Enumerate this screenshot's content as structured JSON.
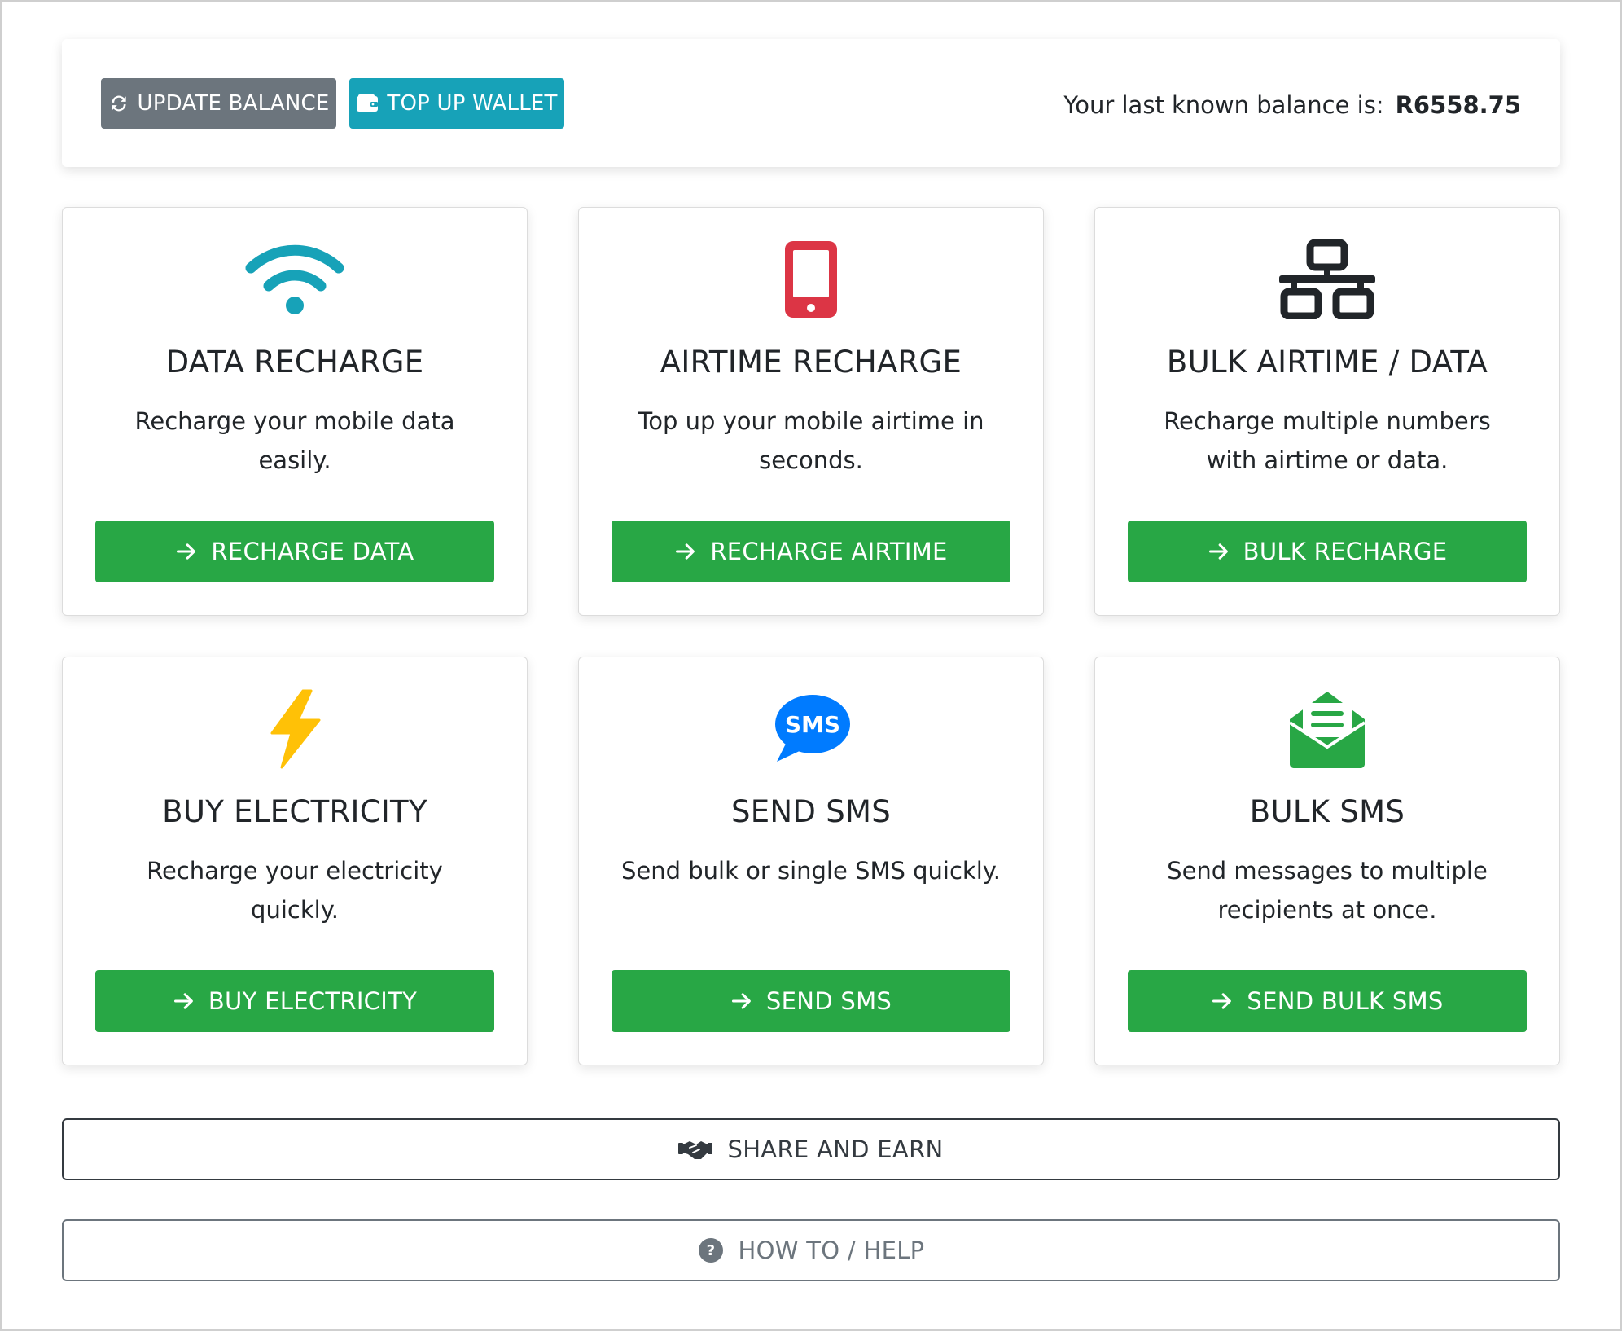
{
  "topbar": {
    "update_label": "UPDATE BALANCE",
    "topup_label": "TOP UP WALLET",
    "balance_text": "Your last known balance is:",
    "balance_amount": "R6558.75"
  },
  "cards": [
    {
      "title": "DATA RECHARGE",
      "desc": "Recharge your mobile data easily.",
      "action": "RECHARGE DATA",
      "icon": "wifi-icon",
      "icon_color": "#17a2b8"
    },
    {
      "title": "AIRTIME RECHARGE",
      "desc": "Top up your mobile airtime in seconds.",
      "action": "RECHARGE AIRTIME",
      "icon": "mobile-phone-icon",
      "icon_color": "#dc3545"
    },
    {
      "title": "BULK AIRTIME / DATA",
      "desc": "Recharge multiple numbers with airtime or data.",
      "action": "BULK RECHARGE",
      "icon": "network-icon",
      "icon_color": "#212529"
    },
    {
      "title": "BUY ELECTRICITY",
      "desc": "Recharge your electricity quickly.",
      "action": "BUY ELECTRICITY",
      "icon": "lightning-bolt-icon",
      "icon_color": "#ffc107"
    },
    {
      "title": "SEND SMS",
      "desc": "Send bulk or single SMS quickly.",
      "action": "SEND SMS",
      "icon": "sms-icon",
      "icon_color": "#007bff"
    },
    {
      "title": "BULK SMS",
      "desc": "Send messages to multiple recipients at once.",
      "action": "SEND BULK SMS",
      "icon": "envelope-open-icon",
      "icon_color": "#28a745"
    }
  ],
  "share": {
    "label": "SHARE AND EARN",
    "icon": "handshake-icon"
  },
  "help": {
    "label": "HOW TO / HELP",
    "icon": "question-circle-icon"
  },
  "colors": {
    "secondary": "#6c757d",
    "info": "#17a2b8",
    "success": "#28a745",
    "danger": "#dc3545",
    "warning": "#ffc107",
    "primary": "#007bff",
    "dark": "#343a40"
  }
}
